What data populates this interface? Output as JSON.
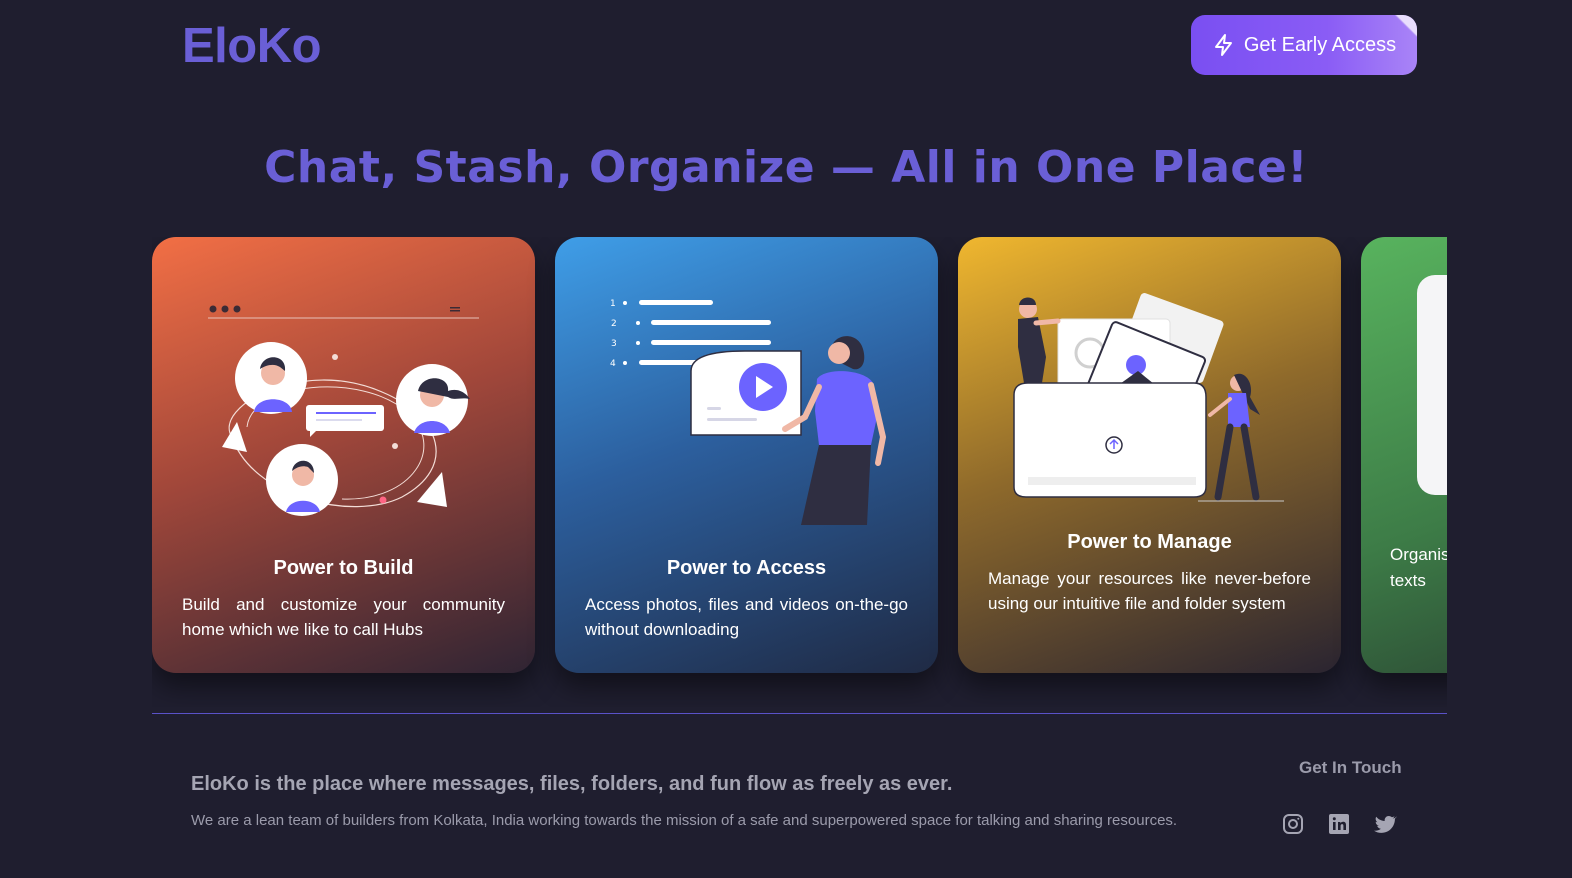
{
  "header": {
    "logo": "EloKo",
    "cta_label": "Get Early Access"
  },
  "hero": {
    "title": "Chat, Stash, Organize — All in One Place!"
  },
  "cards": [
    {
      "title": "Power to Build",
      "description": "Build and customize your community home which we like to call Hubs",
      "color": "#f26f45"
    },
    {
      "title": "Power to Access",
      "description": "Access photos, files and videos on-the-go without downloading",
      "color": "#3f9ee8"
    },
    {
      "title": "Power to Manage",
      "description": "Manage your resources like never-before using our intuitive file and folder system",
      "color": "#f0b72f"
    },
    {
      "title": "",
      "description": "Organis chat in ideas d texts",
      "color": "#58b35e"
    }
  ],
  "illustration_list_numbers": [
    "1",
    "2",
    "3",
    "4"
  ],
  "footer": {
    "tagline": "EloKo is the place where messages, files, folders, and fun flow as freely as ever.",
    "about": "We are a lean team of builders from Kolkata, India working towards the mission of a safe and superpowered space for talking and sharing resources.",
    "contact_title": "Get In Touch",
    "socials": [
      "instagram-icon",
      "linkedin-icon",
      "twitter-icon"
    ]
  },
  "colors": {
    "background": "#1f1e2f",
    "brand": "#6a5fd6",
    "accent_purple": "#6c63ff"
  }
}
